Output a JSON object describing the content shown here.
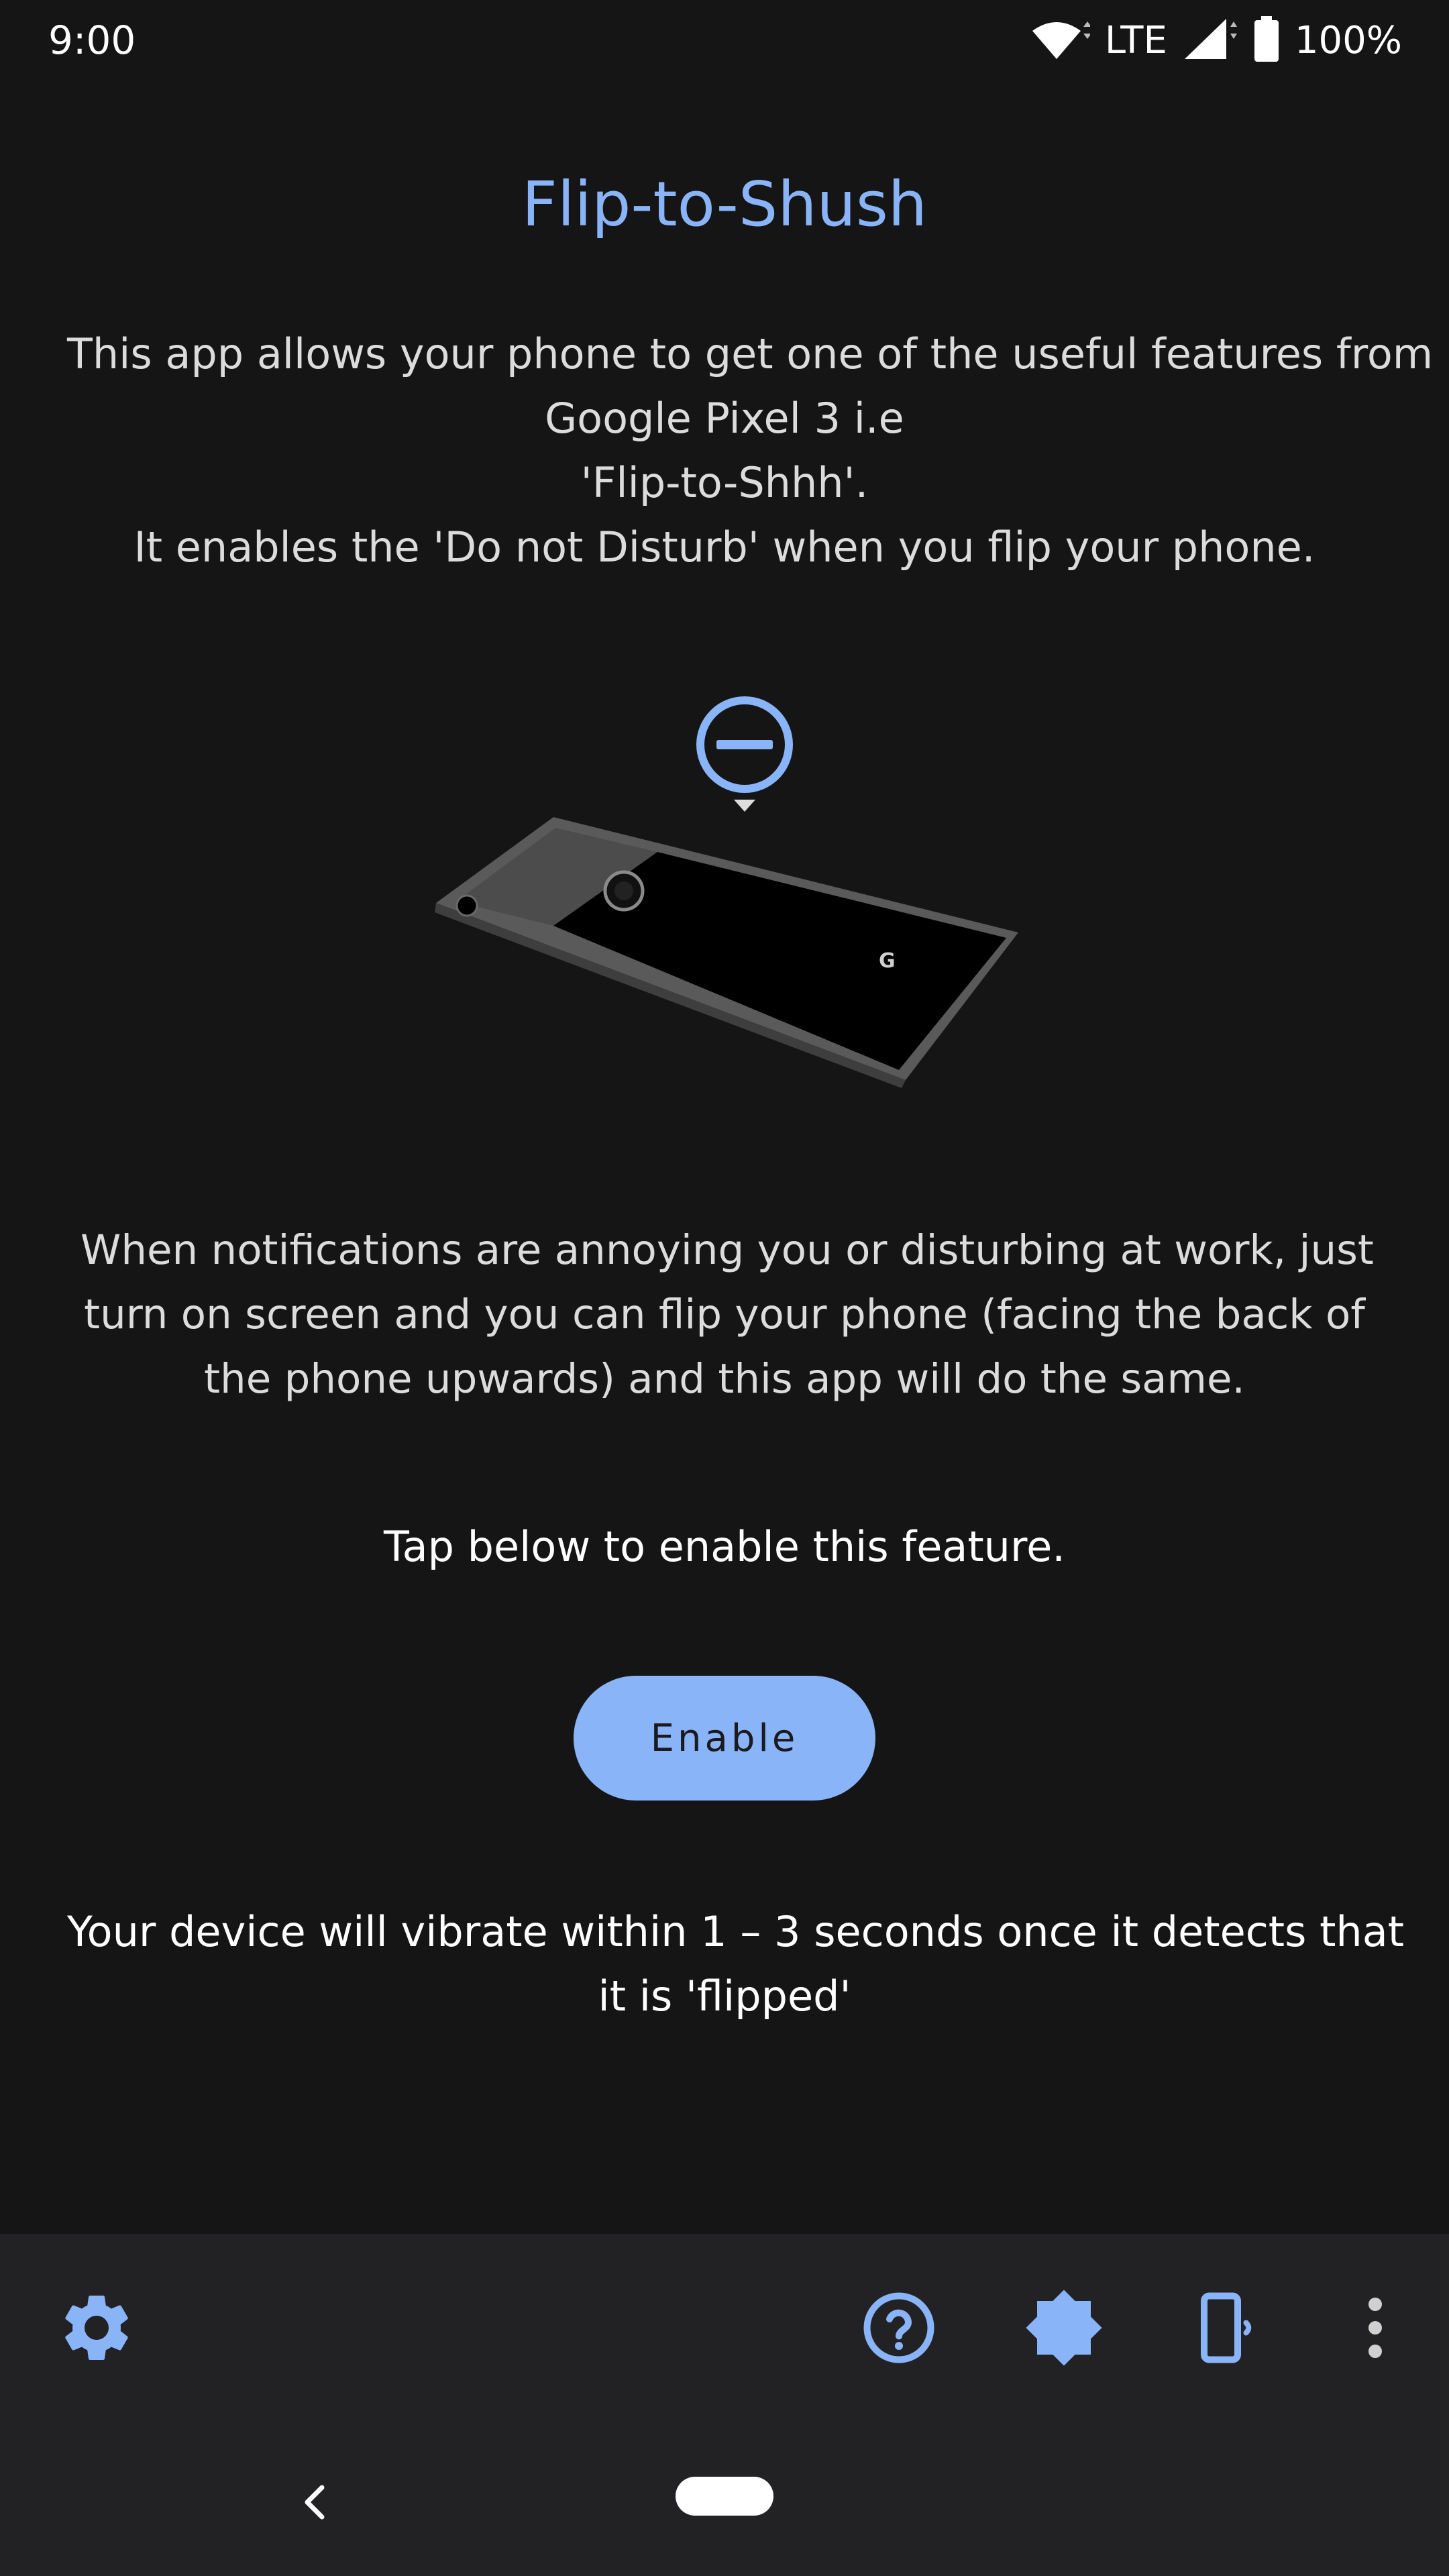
{
  "status_bar": {
    "time": "9:00",
    "network": "LTE",
    "battery": "100%",
    "icons": [
      "wifi-icon",
      "signal-icon",
      "battery-icon"
    ]
  },
  "title": "Flip-to-Shush",
  "intro_lines": [
    "This app allows your phone to get one of the useful features from",
    "Google Pixel 3 i.e",
    "'Flip-to-Shhh'.",
    "It enables the 'Do not Disturb' when you flip your phone."
  ],
  "illustration": {
    "icons": [
      "do-not-disturb-icon",
      "phone-facedown-illustration"
    ]
  },
  "description_lines": [
    "When notifications are annoying you or disturbing at work, just",
    "turn on screen and you can flip your phone (facing the back of",
    "the phone upwards) and this app will do the same."
  ],
  "tap_text": "Tap below to enable this feature.",
  "enable_button": "Enable",
  "note_lines": [
    "Your device will vibrate within 1 – 3 seconds once it detects that",
    "it is 'flipped'"
  ],
  "bottom_bar": {
    "icons": [
      "settings-icon",
      "help-icon",
      "theme-icon",
      "vibrate-icon",
      "more-vert-icon"
    ]
  },
  "navigation": {
    "icons": [
      "back-icon",
      "home-pill-icon"
    ]
  },
  "colors": {
    "background": "#151516",
    "accent": "#8ab4f8",
    "bar": "#222224"
  }
}
